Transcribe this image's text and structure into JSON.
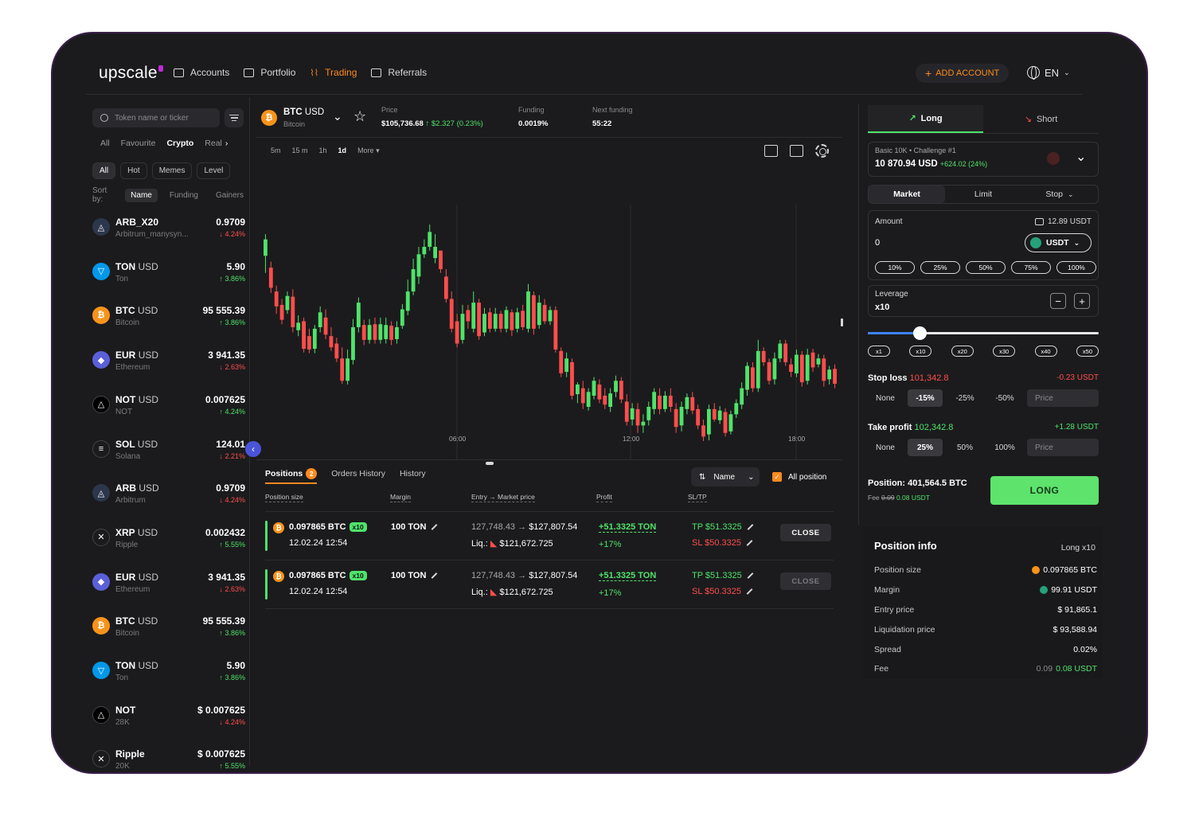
{
  "brand": "upscale",
  "nav": [
    {
      "label": "Accounts",
      "icon": "wallet-icon"
    },
    {
      "label": "Portfolio",
      "icon": "briefcase-icon"
    },
    {
      "label": "Trading",
      "icon": "trading-icon"
    },
    {
      "label": "Referrals",
      "icon": "calendar-icon"
    }
  ],
  "add_account": "ADD ACCOUNT",
  "language": "EN",
  "sidebar": {
    "search_placeholder": "Token name or ticker",
    "cat_tabs": [
      "All",
      "Favourite",
      "Crypto",
      "Real"
    ],
    "active_cat": "Crypto",
    "chips": [
      "All",
      "Hot",
      "Memes",
      "Level"
    ],
    "sort_label": "Sort by:",
    "sort_options": [
      "Name",
      "Funding",
      "Gainers"
    ],
    "tokens": [
      {
        "sym": "ARB_X20",
        "quote": "",
        "sub": "Arbitrum_manysyn...",
        "price": "0.9709",
        "chg": "↓ 4.24%",
        "dir": "down",
        "icon": "arbitrum-icon",
        "color": "#2c374b"
      },
      {
        "sym": "TON",
        "quote": "USD",
        "sub": "Ton",
        "price": "5.90",
        "chg": "↑ 3.86%",
        "dir": "up",
        "icon": "ton-icon",
        "color": "#0098ea"
      },
      {
        "sym": "BTC",
        "quote": "USD",
        "sub": "Bitcoin",
        "price": "95 555.39",
        "chg": "↑ 3.86%",
        "dir": "up",
        "icon": "bitcoin-icon",
        "color": "#f7931a"
      },
      {
        "sym": "EUR",
        "quote": "USD",
        "sub": "Ethereum",
        "price": "3 941.35",
        "chg": "↓ 2.63%",
        "dir": "down",
        "icon": "ethereum-icon",
        "color": "#5b5fd8"
      },
      {
        "sym": "NOT",
        "quote": "USD",
        "sub": "NOT",
        "price": "0.007625",
        "chg": "↑ 4.24%",
        "dir": "up",
        "icon": "notcoin-icon",
        "color": "#000000"
      },
      {
        "sym": "SOL",
        "quote": "USD",
        "sub": "Solana",
        "price": "124.01",
        "chg": "↓ 2.21%",
        "dir": "down",
        "icon": "solana-icon",
        "color": "#1b1b1d"
      },
      {
        "sym": "ARB",
        "quote": "USD",
        "sub": "Arbitrum",
        "price": "0.9709",
        "chg": "↓ 4.24%",
        "dir": "down",
        "icon": "arbitrum-icon",
        "color": "#2c374b"
      },
      {
        "sym": "XRP",
        "quote": "USD",
        "sub": "Ripple",
        "price": "0.002432",
        "chg": "↑ 5.55%",
        "dir": "up",
        "icon": "ripple-icon",
        "color": "#1b1b1d"
      },
      {
        "sym": "EUR",
        "quote": "USD",
        "sub": "Ethereum",
        "price": "3 941.35",
        "chg": "↓ 2.63%",
        "dir": "down",
        "icon": "ethereum-icon",
        "color": "#5b5fd8"
      },
      {
        "sym": "BTC",
        "quote": "USD",
        "sub": "Bitcoin",
        "price": "95 555.39",
        "chg": "↑ 3.86%",
        "dir": "up",
        "icon": "bitcoin-icon",
        "color": "#f7931a"
      },
      {
        "sym": "TON",
        "quote": "USD",
        "sub": "Ton",
        "price": "5.90",
        "chg": "↑ 3.86%",
        "dir": "up",
        "icon": "ton-icon",
        "color": "#0098ea"
      },
      {
        "sym": "NOT",
        "quote": "",
        "sub": "28K",
        "price": "$ 0.007625",
        "chg": "↓ 4.24%",
        "dir": "down",
        "icon": "notcoin-icon",
        "color": "#000000"
      },
      {
        "sym": "Ripple",
        "quote": "",
        "sub": "20K",
        "price": "$ 0.007625",
        "chg": "↑ 5.55%",
        "dir": "up",
        "icon": "ripple-icon",
        "color": "#1b1b1d"
      }
    ]
  },
  "chart_header": {
    "pair": "BTC",
    "quote": "USD",
    "name": "Bitcoin",
    "price_label": "Price",
    "price": "$105,736.68",
    "price_change": "↑ $2.327 (0.23%)",
    "funding_label": "Funding",
    "funding": "0.0019%",
    "next_funding_label": "Next funding",
    "next_funding": "55:22"
  },
  "timeframes": [
    "5m",
    "15 m",
    "1h",
    "1d",
    "More ▾"
  ],
  "active_timeframe": "1d",
  "chart_data": {
    "type": "candlestick",
    "x_ticks": [
      "06:00",
      "12:00",
      "18:00"
    ],
    "candles": [
      [
        468,
        490,
        445,
        497
      ],
      [
        452,
        425,
        418,
        460
      ],
      [
        420,
        400,
        390,
        428
      ],
      [
        402,
        382,
        376,
        410
      ],
      [
        395,
        414,
        390,
        420
      ],
      [
        413,
        372,
        365,
        423
      ],
      [
        368,
        378,
        360,
        388
      ],
      [
        380,
        343,
        338,
        385
      ],
      [
        360,
        342,
        337,
        370
      ],
      [
        343,
        370,
        337,
        375
      ],
      [
        372,
        392,
        365,
        400
      ],
      [
        385,
        362,
        356,
        396
      ],
      [
        360,
        345,
        340,
        372
      ],
      [
        350,
        330,
        325,
        358
      ],
      [
        330,
        300,
        296,
        345
      ],
      [
        300,
        330,
        295,
        342
      ],
      [
        328,
        372,
        322,
        383
      ],
      [
        372,
        405,
        365,
        412
      ],
      [
        375,
        355,
        348,
        382
      ],
      [
        355,
        375,
        350,
        383
      ],
      [
        376,
        355,
        350,
        385
      ],
      [
        355,
        376,
        350,
        385
      ],
      [
        356,
        375,
        350,
        385
      ],
      [
        374,
        355,
        348,
        380
      ],
      [
        356,
        372,
        350,
        380
      ],
      [
        374,
        396,
        370,
        403
      ],
      [
        394,
        420,
        388,
        436
      ],
      [
        420,
        450,
        415,
        464
      ],
      [
        440,
        470,
        430,
        480
      ],
      [
        470,
        480,
        465,
        490
      ],
      [
        480,
        500,
        475,
        510
      ],
      [
        465,
        480,
        458,
        497
      ],
      [
        475,
        450,
        445,
        465
      ],
      [
        440,
        410,
        405,
        450
      ],
      [
        410,
        370,
        365,
        420
      ],
      [
        380,
        350,
        345,
        390
      ],
      [
        355,
        390,
        350,
        402
      ],
      [
        395,
        380,
        370,
        402
      ],
      [
        370,
        405,
        365,
        420
      ],
      [
        405,
        360,
        355,
        410
      ],
      [
        365,
        390,
        360,
        398
      ],
      [
        392,
        370,
        365,
        398
      ],
      [
        370,
        390,
        366,
        398
      ],
      [
        390,
        370,
        365,
        394
      ],
      [
        370,
        395,
        365,
        400
      ],
      [
        392,
        368,
        360,
        396
      ],
      [
        370,
        392,
        365,
        398
      ],
      [
        394,
        372,
        368,
        402
      ],
      [
        370,
        420,
        365,
        430
      ],
      [
        415,
        370,
        362,
        420
      ],
      [
        375,
        405,
        370,
        415
      ],
      [
        402,
        380,
        376,
        410
      ],
      [
        380,
        395,
        375,
        400
      ],
      [
        395,
        342,
        338,
        400
      ],
      [
        340,
        310,
        305,
        345
      ],
      [
        312,
        330,
        305,
        338
      ],
      [
        325,
        280,
        275,
        330
      ],
      [
        282,
        295,
        270,
        298
      ],
      [
        290,
        270,
        262,
        300
      ],
      [
        265,
        285,
        260,
        290
      ],
      [
        280,
        300,
        275,
        305
      ],
      [
        295,
        275,
        270,
        302
      ],
      [
        280,
        268,
        262,
        290
      ],
      [
        265,
        283,
        258,
        290
      ],
      [
        285,
        300,
        278,
        307
      ],
      [
        300,
        275,
        270,
        305
      ],
      [
        272,
        245,
        240,
        282
      ],
      [
        248,
        263,
        240,
        270
      ],
      [
        262,
        240,
        230,
        270
      ],
      [
        240,
        245,
        230,
        255
      ],
      [
        247,
        265,
        240,
        272
      ],
      [
        262,
        285,
        255,
        290
      ],
      [
        280,
        262,
        255,
        290
      ],
      [
        262,
        280,
        258,
        286
      ],
      [
        280,
        265,
        258,
        290
      ],
      [
        262,
        238,
        230,
        270
      ],
      [
        240,
        265,
        232,
        272
      ],
      [
        262,
        278,
        255,
        283
      ],
      [
        278,
        260,
        255,
        285
      ],
      [
        262,
        240,
        235,
        268
      ],
      [
        240,
        225,
        219,
        248
      ],
      [
        228,
        262,
        220,
        268
      ],
      [
        262,
        248,
        245,
        270
      ],
      [
        247,
        260,
        242,
        266
      ],
      [
        258,
        230,
        225,
        263
      ],
      [
        232,
        255,
        228,
        260
      ],
      [
        255,
        270,
        250,
        275
      ],
      [
        268,
        290,
        262,
        298
      ],
      [
        288,
        320,
        280,
        325
      ],
      [
        318,
        290,
        285,
        325
      ],
      [
        290,
        340,
        285,
        355
      ],
      [
        340,
        325,
        320,
        345
      ],
      [
        325,
        300,
        295,
        330
      ],
      [
        302,
        330,
        295,
        338
      ],
      [
        330,
        350,
        325,
        355
      ],
      [
        350,
        325,
        320,
        355
      ],
      [
        322,
        312,
        305,
        330
      ],
      [
        310,
        335,
        305,
        342
      ],
      [
        335,
        298,
        292,
        340
      ],
      [
        300,
        335,
        295,
        343
      ],
      [
        338,
        318,
        312,
        343
      ],
      [
        322,
        330,
        318,
        336
      ],
      [
        330,
        300,
        292,
        335
      ],
      [
        302,
        315,
        295,
        320
      ],
      [
        316,
        296,
        290,
        322
      ]
    ]
  },
  "positions": {
    "tabs": [
      "Positions",
      "Orders History",
      "History"
    ],
    "count": "2",
    "sort_label": "Name",
    "all_position_label": "All position",
    "columns": [
      "Position size",
      "Margin",
      "Entry → Market price",
      "Profit",
      "SL/TP"
    ],
    "rows": [
      {
        "size": "0.097865 BTC",
        "lev": "x10",
        "date": "12.02.24 12:54",
        "margin": "100 TON",
        "entry": "127,748.43",
        "market": "$127,807.54",
        "liq_label": "Liq.:",
        "liq": "$121,672.725",
        "profit": "+51.3325 TON",
        "profit_pct": "+17%",
        "tp": "TP $51.3325",
        "sl": "SL $50.3325",
        "action": "CLOSE"
      },
      {
        "size": "0.097865 BTC",
        "lev": "x10",
        "date": "12.02.24 12:54",
        "margin": "100 TON",
        "entry": "127,748.43",
        "market": "$127,807.54",
        "liq_label": "Liq.:",
        "liq": "$121,672.725",
        "profit": "+51.3325 TON",
        "profit_pct": "+17%",
        "tp": "TP $51.3325",
        "sl": "SL $50.3325",
        "action": "CLOSE"
      }
    ]
  },
  "order_panel": {
    "long_label": "Long",
    "short_label": "Short",
    "account_name": "Basic 10K • Challenge #1",
    "account_balance": "10 870.94 USD",
    "account_change": "+624.02 (24%)",
    "order_types": [
      "Market",
      "Limit",
      "Stop"
    ],
    "amount_label": "Amount",
    "available": "12.89 USDT",
    "amount_value": "0",
    "currency": "USDT",
    "pct_options": [
      "10%",
      "25%",
      "50%",
      "75%",
      "100%"
    ],
    "leverage_label": "Leverage",
    "leverage_value": "x10",
    "leverage_level": "x10",
    "leverage_marks": [
      "x1",
      "x10",
      "x20",
      "x30",
      "x40",
      "x50"
    ],
    "stop_loss_label": "Stop loss",
    "stop_loss_value": "101,342.8",
    "stop_loss_usdt": "-0.23 USDT",
    "sl_options": [
      "None",
      "-15%",
      "-25%",
      "-50%"
    ],
    "sl_active": "-15%",
    "take_profit_label": "Take profit",
    "take_profit_value": "102,342.8",
    "take_profit_usdt": "+1.28 USDT",
    "tp_options": [
      "None",
      "25%",
      "50%",
      "100%"
    ],
    "tp_active": "25%",
    "price_placeholder": "Price",
    "position_summary": "Position: 401,564.5 BTC",
    "fee_label": "Fee",
    "fee_old": "0.09",
    "fee_new": "0.08 USDT",
    "submit": "LONG"
  },
  "position_info": {
    "title": "Position info",
    "mode": "Long x10",
    "rows": [
      {
        "k": "Position size",
        "v": "0.097865 BTC",
        "icon": "bitcoin-icon"
      },
      {
        "k": "Margin",
        "v": "99.91 USDT",
        "icon": "usdt-icon"
      },
      {
        "k": "Entry price",
        "v": "$ 91,865.1",
        "icon": ""
      },
      {
        "k": "Liquidation price",
        "v": "$ 93,588.94",
        "icon": ""
      },
      {
        "k": "Spread",
        "v": "0.02%",
        "icon": ""
      }
    ],
    "fee_label": "Fee",
    "fee_old": "0.09",
    "fee_new": "0.08 USDT"
  },
  "colors": {
    "up": "#4fe36a",
    "down": "#ff4d4d",
    "accent": "#ff8a1f",
    "bg": "#1b1b1d"
  }
}
